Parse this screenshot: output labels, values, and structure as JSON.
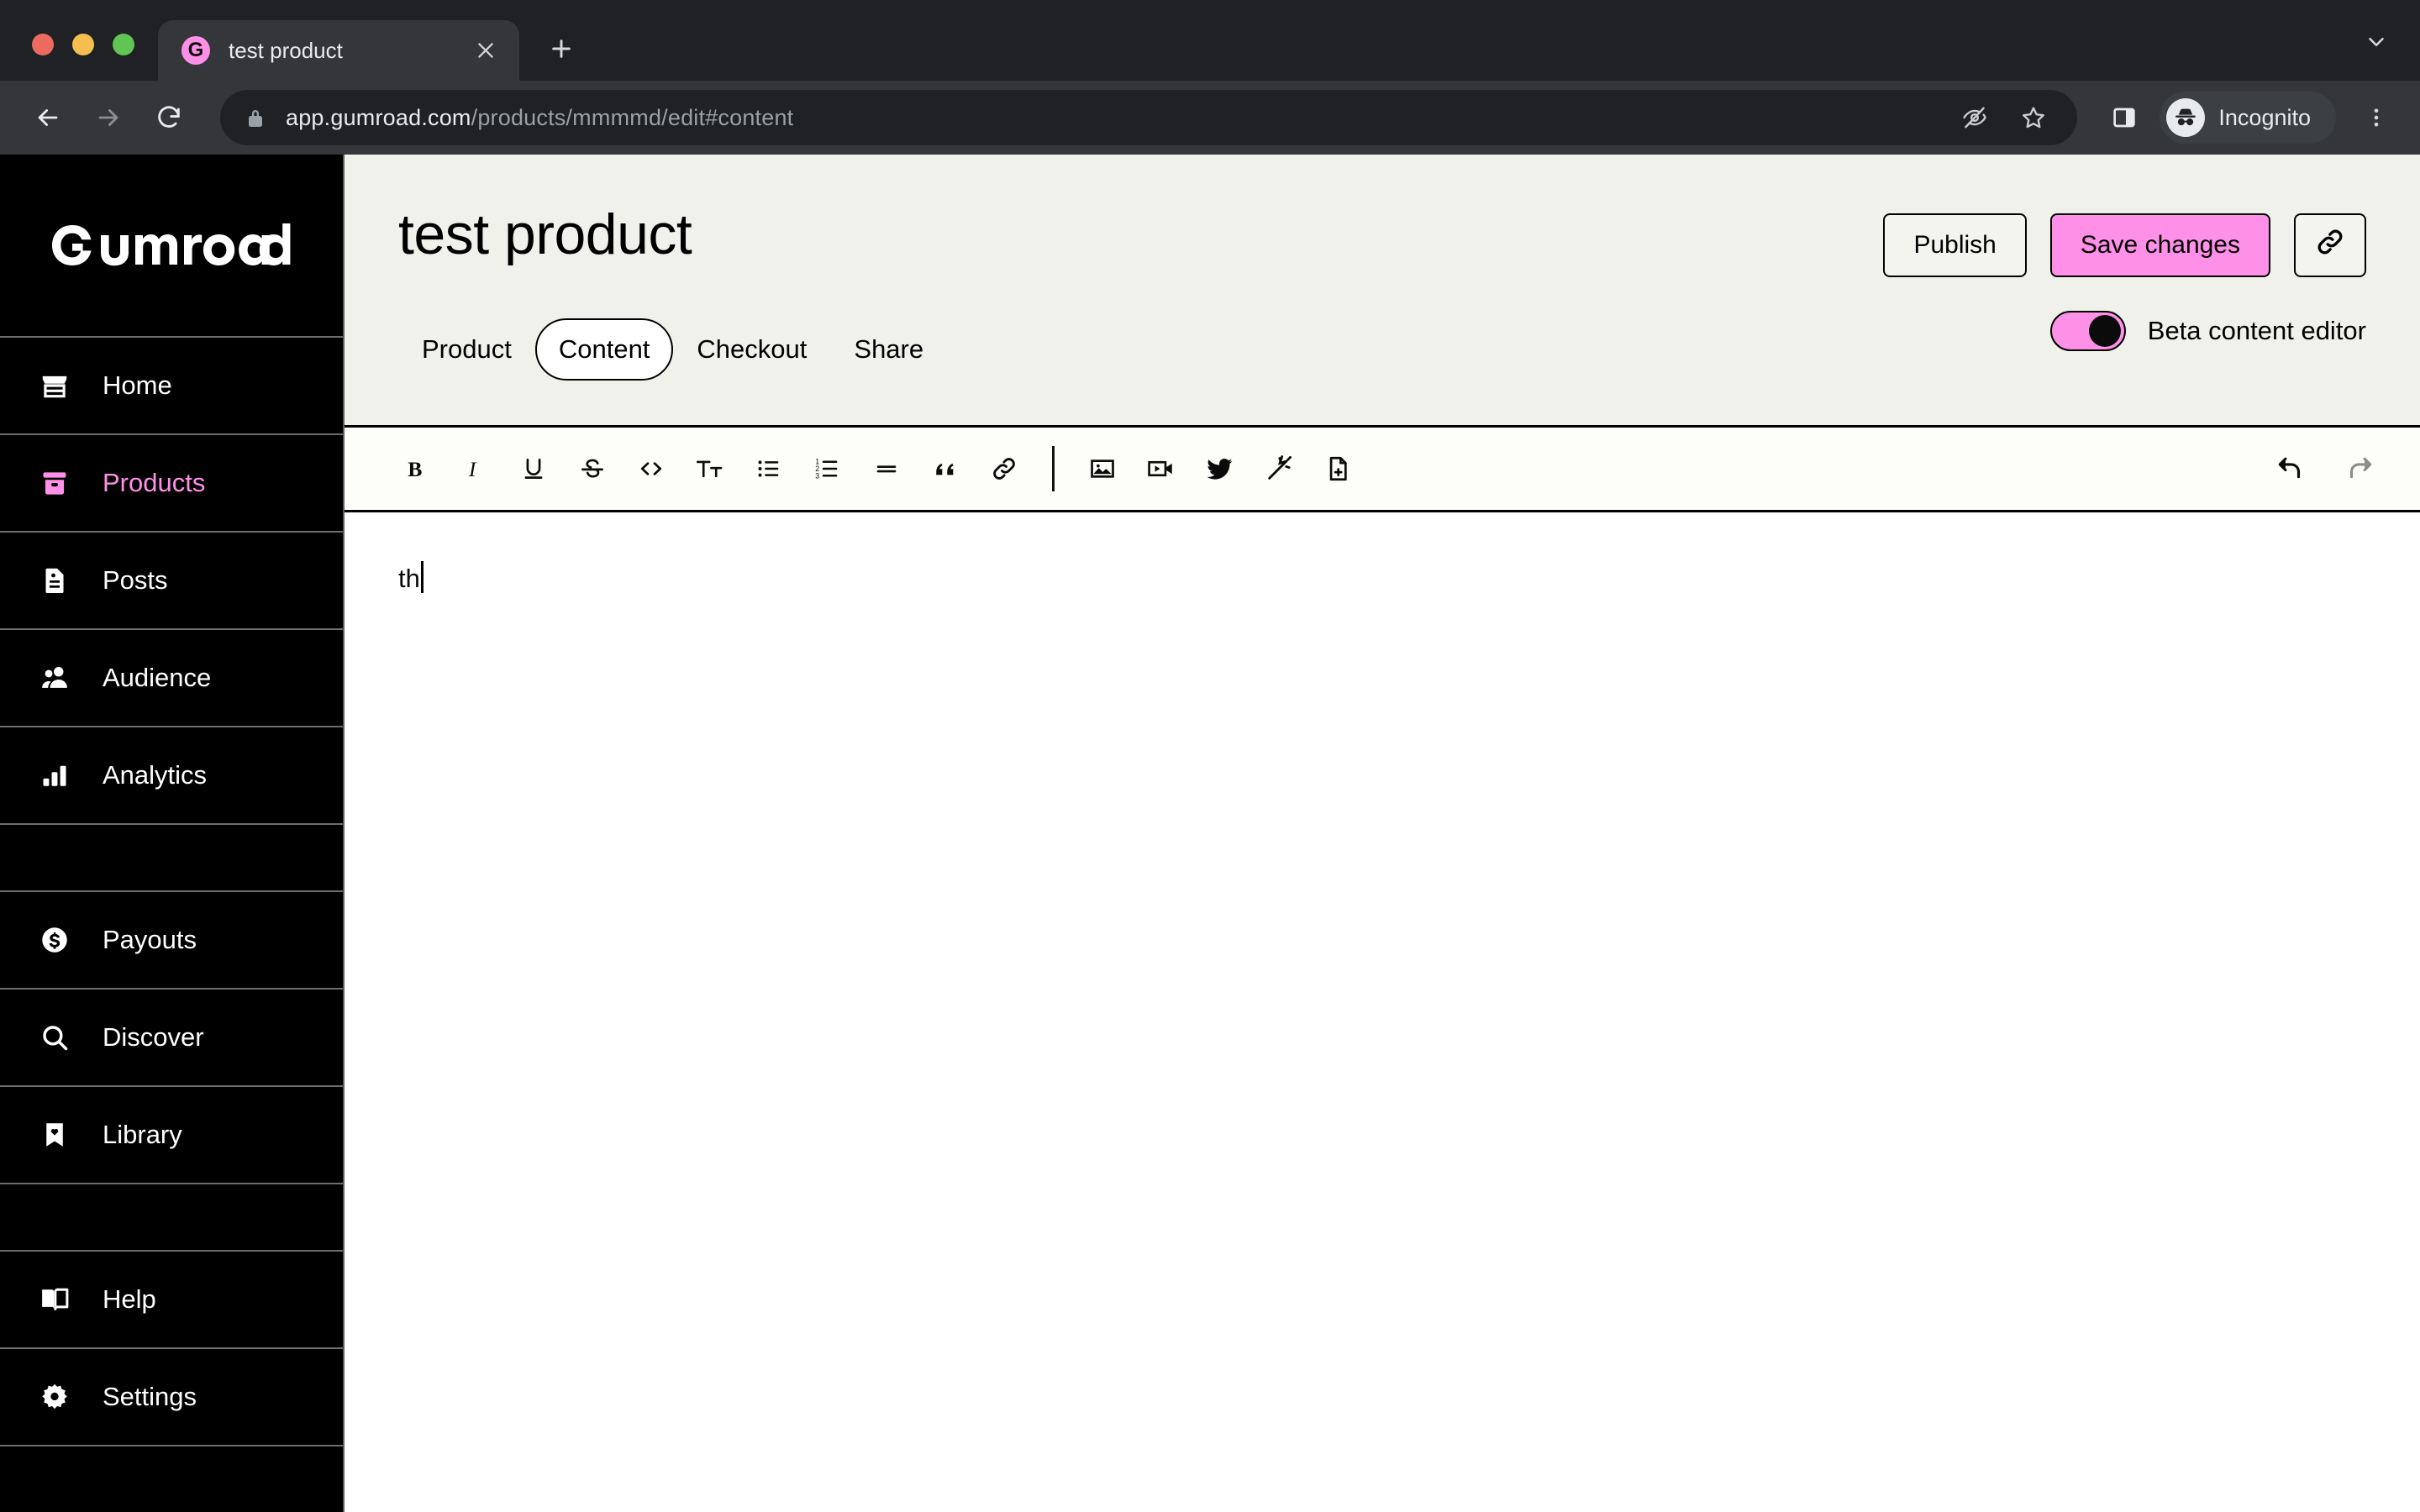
{
  "browser": {
    "tab": {
      "title": "test product",
      "favicon_letter": "G",
      "favicon_color": "#FF90E8"
    },
    "new_tab_label": "+",
    "url": {
      "domain": "app.gumroad.com",
      "path": "/products/mmmmd/edit#content",
      "full": "app.gumroad.com/products/mmmmd/edit#content"
    },
    "profile": {
      "label": "Incognito"
    },
    "icons": {
      "back": "back-arrow-icon",
      "forward": "forward-arrow-icon",
      "reload": "reload-icon",
      "lock": "lock-icon",
      "tracking_blocked": "eye-slash-icon",
      "bookmark": "star-icon",
      "side_panel": "side-panel-icon",
      "menu": "three-dot-menu-icon",
      "tab_list": "chevron-down-icon",
      "close_tab": "close-icon"
    }
  },
  "sidebar": {
    "brand": "GUMROAD",
    "items": [
      {
        "label": "Home",
        "icon": "storefront-icon",
        "active": false
      },
      {
        "label": "Products",
        "icon": "box-icon",
        "active": true
      },
      {
        "label": "Posts",
        "icon": "document-icon",
        "active": false
      },
      {
        "label": "Audience",
        "icon": "people-icon",
        "active": false
      },
      {
        "label": "Analytics",
        "icon": "bar-chart-icon",
        "active": false
      },
      {
        "label": "Payouts",
        "icon": "dollar-circle-icon",
        "active": false
      },
      {
        "label": "Discover",
        "icon": "search-icon",
        "active": false
      },
      {
        "label": "Library",
        "icon": "bookmark-heart-icon",
        "active": false
      },
      {
        "label": "Help",
        "icon": "open-book-icon",
        "active": false
      },
      {
        "label": "Settings",
        "icon": "gear-icon",
        "active": false
      }
    ],
    "accent_color": "#FF90E8"
  },
  "header": {
    "product_title": "test product",
    "actions": {
      "publish_label": "Publish",
      "save_label": "Save changes",
      "link_icon": "link-icon"
    },
    "tabs": [
      {
        "label": "Product",
        "active": false
      },
      {
        "label": "Content",
        "active": true
      },
      {
        "label": "Checkout",
        "active": false
      },
      {
        "label": "Share",
        "active": false
      }
    ],
    "beta_toggle": {
      "label": "Beta content editor",
      "enabled": true,
      "color": "#FF90E8"
    }
  },
  "editor": {
    "toolbar": {
      "format_group": [
        {
          "icon": "bold-icon",
          "label": "B"
        },
        {
          "icon": "italic-icon",
          "label": "I"
        },
        {
          "icon": "underline-icon",
          "label": "U"
        },
        {
          "icon": "strikethrough-icon",
          "label": "S"
        },
        {
          "icon": "code-icon",
          "label": "<>"
        },
        {
          "icon": "text-size-icon",
          "label": "Tt"
        },
        {
          "icon": "bullet-list-icon",
          "label": ""
        },
        {
          "icon": "numbered-list-icon",
          "label": ""
        },
        {
          "icon": "horizontal-rule-icon",
          "label": ""
        },
        {
          "icon": "blockquote-icon",
          "label": ""
        },
        {
          "icon": "link-icon",
          "label": ""
        }
      ],
      "insert_group": [
        {
          "icon": "image-icon",
          "label": ""
        },
        {
          "icon": "video-icon",
          "label": ""
        },
        {
          "icon": "twitter-icon",
          "label": ""
        },
        {
          "icon": "magic-wand-icon",
          "label": ""
        },
        {
          "icon": "file-add-icon",
          "label": ""
        }
      ],
      "history_group": [
        {
          "icon": "undo-icon",
          "enabled": true
        },
        {
          "icon": "redo-icon",
          "enabled": false
        }
      ]
    },
    "content_text": "th"
  },
  "colors": {
    "accent_pink": "#FF90E8",
    "cream": "#F1F1EC",
    "black": "#000000"
  }
}
